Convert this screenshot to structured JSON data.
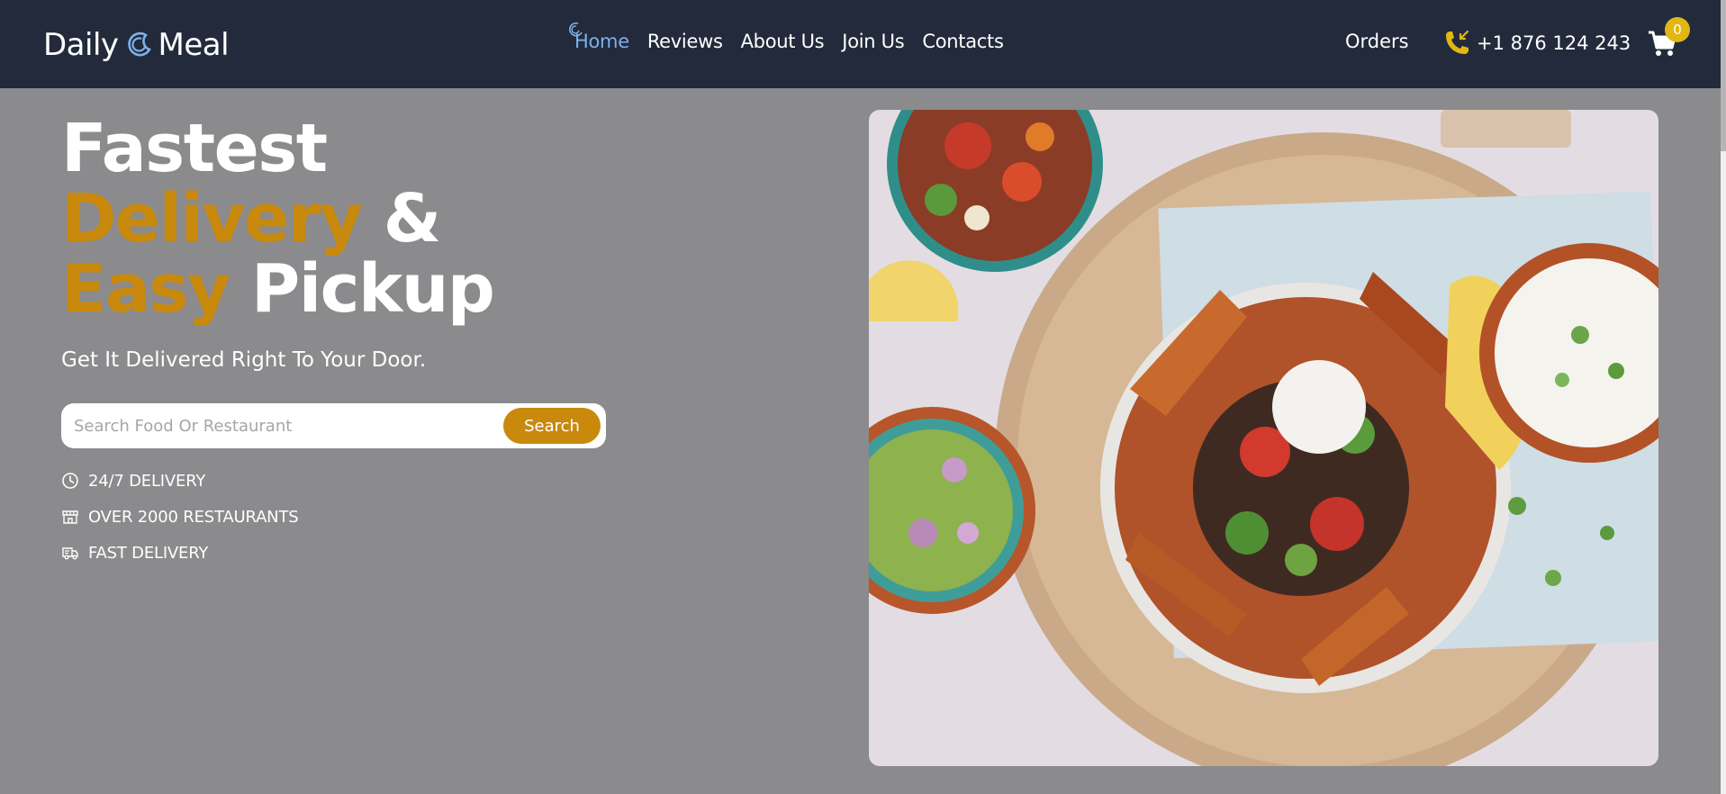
{
  "colors": {
    "navbar_bg": "#222a3b",
    "page_bg": "#8b8a8c",
    "accent": "#c8890d",
    "active_link": "#7fb0ea",
    "badge": "#e2b714"
  },
  "header": {
    "logo_left": "Daily",
    "logo_right": "Meal",
    "nav": [
      {
        "label": "Home",
        "active": true
      },
      {
        "label": "Reviews"
      },
      {
        "label": "About Us"
      },
      {
        "label": "Join Us"
      },
      {
        "label": "Contacts"
      }
    ],
    "orders_label": "Orders",
    "phone": "+1 876 124 243",
    "cart_count": "0"
  },
  "hero": {
    "title": {
      "line1": "Fastest",
      "line2_accent": "Delivery",
      "line2_rest": "&",
      "line3_accent": "Easy",
      "line3_rest": "Pickup"
    },
    "subtitle": "Get It Delivered Right To Your Door.",
    "search": {
      "placeholder": "Search Food Or Restaurant",
      "button_label": "Search"
    },
    "features": [
      {
        "icon": "clock-icon",
        "label": "24/7 DELIVERY"
      },
      {
        "icon": "store-icon",
        "label": "OVER 2000 RESTAURANTS"
      },
      {
        "icon": "truck-icon",
        "label": "FAST DELIVERY"
      }
    ],
    "image": {
      "subject": "food-bowl-photo"
    }
  }
}
